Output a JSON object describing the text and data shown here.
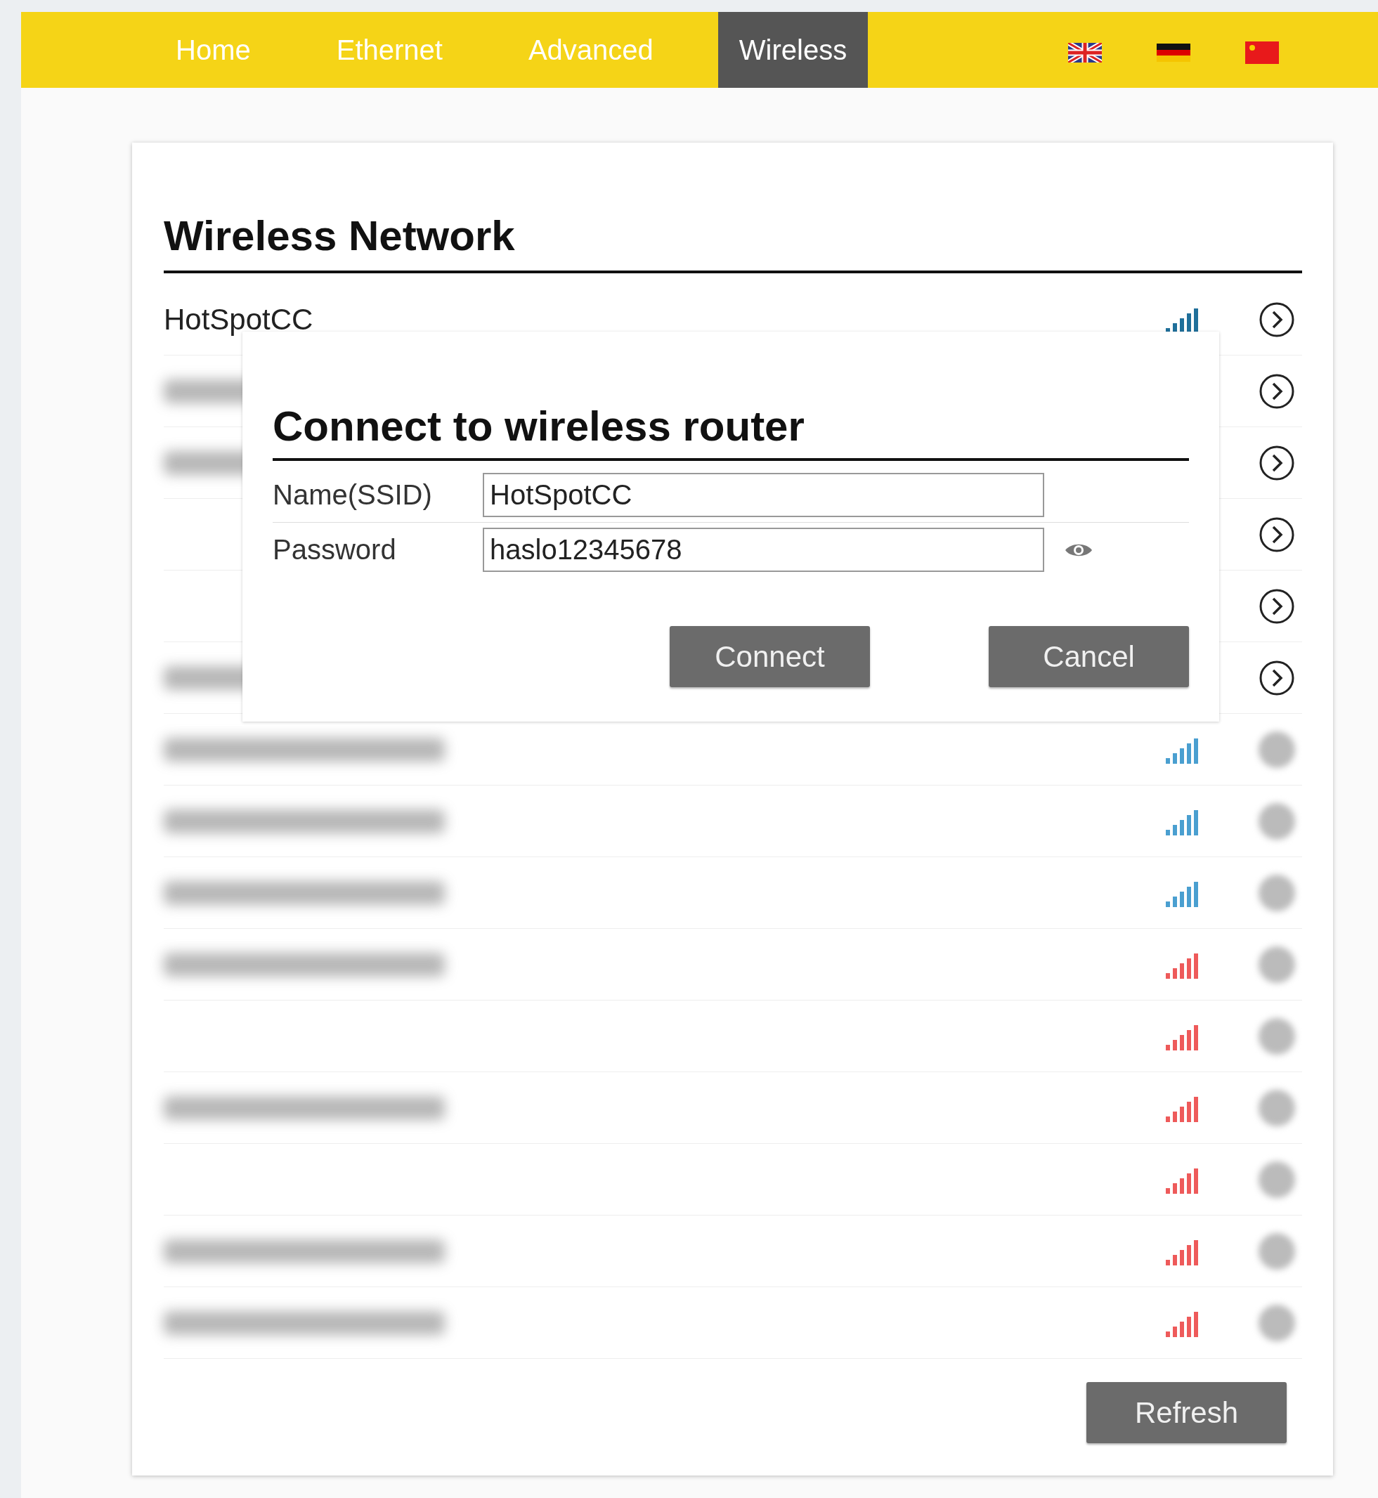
{
  "nav": {
    "tabs": [
      {
        "label": "Home",
        "selected": false
      },
      {
        "label": "Ethernet",
        "selected": false
      },
      {
        "label": "Advanced",
        "selected": false
      },
      {
        "label": "Wireless",
        "selected": true
      }
    ]
  },
  "panel": {
    "title": "Wireless Network",
    "networks": [
      {
        "kind": "named",
        "name": "HotSpotCC",
        "color": "#1f6f9a"
      },
      {
        "kind": "masked"
      },
      {
        "kind": "masked"
      },
      {
        "kind": "masked-blank"
      },
      {
        "kind": "masked-blank"
      },
      {
        "kind": "masked"
      },
      {
        "kind": "blurred",
        "color": "#4a9fd0"
      },
      {
        "kind": "blurred",
        "color": "#4a9fd0"
      },
      {
        "kind": "blurred",
        "color": "#4a9fd0"
      },
      {
        "kind": "blurred",
        "color": "#ee5a5a"
      },
      {
        "kind": "blurred-blank",
        "color": "#ee5a5a"
      },
      {
        "kind": "blurred",
        "color": "#ee5a5a"
      },
      {
        "kind": "blurred-blank",
        "color": "#ee5a5a"
      },
      {
        "kind": "blurred",
        "color": "#ee5a5a"
      },
      {
        "kind": "blurred",
        "color": "#ee5a5a"
      }
    ],
    "refresh_button": "Refresh"
  },
  "dialog": {
    "title": "Connect to wireless router",
    "fields": [
      {
        "label": "Name(SSID)",
        "value": "HotSpotCC"
      },
      {
        "label": "Password",
        "value": "haslo12345678"
      }
    ],
    "buttons": [
      "Connect",
      "Cancel"
    ]
  }
}
